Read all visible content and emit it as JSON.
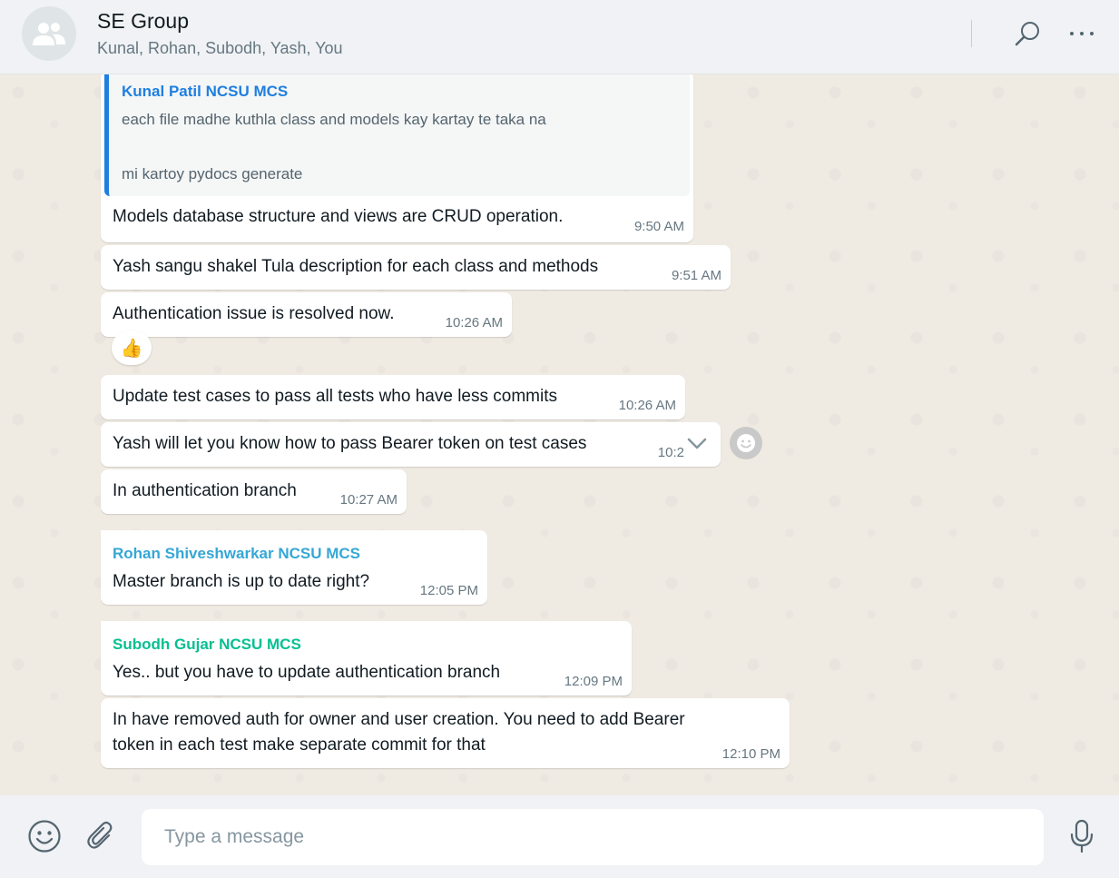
{
  "header": {
    "title": "SE Group",
    "participants": "Kunal, Rohan, Subodh, Yash, You",
    "icons": {
      "avatar": "group-icon",
      "search": "search-icon",
      "menu": "more-icon"
    }
  },
  "quoted": {
    "sender": "Kunal Patil NCSU MCS",
    "sender_color": "#1f7fe0",
    "line1": "each file madhe kuthla class and models kay kartay te taka na",
    "line2": "mi kartoy pydocs generate"
  },
  "messages": [
    {
      "text": "Models database structure and views are CRUD operation.",
      "time": "9:50 AM"
    },
    {
      "text": "Yash sangu shakel Tula description for each class and methods",
      "time": "9:51 AM"
    },
    {
      "text": "Authentication issue is resolved now.",
      "time": "10:26 AM",
      "reaction": "👍"
    },
    {
      "text": "Update test cases to pass all tests who have less commits",
      "time": "10:26 AM"
    },
    {
      "text": "Yash will let you know how to pass Bearer token on test cases",
      "time": "10:2"
    },
    {
      "text": "In authentication branch",
      "time": "10:27 AM"
    },
    {
      "sender": "Rohan Shiveshwarkar NCSU MCS",
      "sender_color": "#35a7d6",
      "text": "Master branch is up to date right?",
      "time": "12:05 PM"
    },
    {
      "sender": "Subodh Gujar NCSU MCS",
      "sender_color": "#06bf91",
      "text": "Yes.. but you have to update authentication branch",
      "time": "12:09 PM"
    },
    {
      "line1": "In have removed auth for owner and user creation. You need to add Bearer",
      "line2": "token in each test make separate commit for that",
      "time": "12:10 PM"
    }
  ],
  "composer": {
    "placeholder": "Type a message",
    "icons": {
      "emoji": "emoji-icon",
      "attach": "attach-icon",
      "mic": "mic-icon"
    }
  }
}
